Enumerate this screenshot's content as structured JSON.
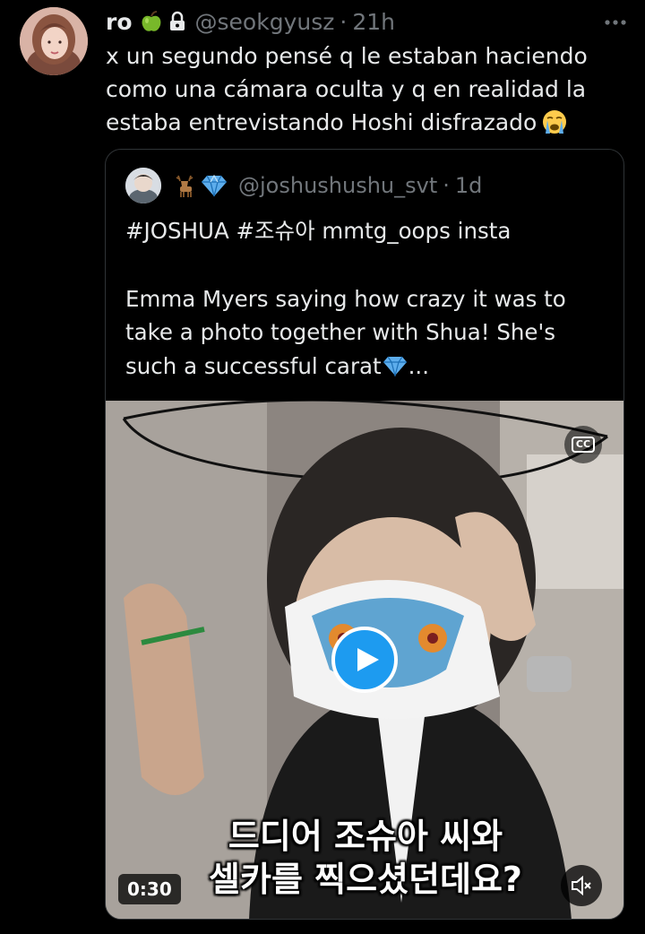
{
  "tweet": {
    "display_name": "ro",
    "name_emoji": "green-apple",
    "protected_icon": "lock-icon",
    "handle": "@seokgyusz",
    "separator": "·",
    "time": "21h",
    "text_lines": [
      "x un segundo pensé q le estaban haciendo",
      "como una cámara oculta y q en realidad la",
      "estaba entrevistando Hoshi disfrazado"
    ],
    "text_emoji": "loudly-crying-face"
  },
  "quoted": {
    "name_emojis": [
      "deer",
      "gem-stone"
    ],
    "handle": "@joshushushu_svt",
    "separator": "·",
    "time": "1d",
    "text_lines": [
      "#JOSHUA #조슈아 mmtg_oops insta",
      "Emma Myers saying how crazy it was to",
      "take a photo together with Shua! She's",
      "such a successful carat"
    ],
    "text_ellipsis": "...",
    "video": {
      "cc_label": "CC",
      "subtitle_lines": [
        "드디어 조슈아 씨와",
        "셀카를 찍으셨던데요?"
      ],
      "duration": "0:30",
      "play_icon": "play-icon",
      "mute_icon": "muted-speaker-icon"
    }
  },
  "colors": {
    "background": "#000000",
    "text": "#e7e9ea",
    "secondary": "#71767b",
    "border": "#2f3336",
    "accent": "#1d9bf0"
  }
}
